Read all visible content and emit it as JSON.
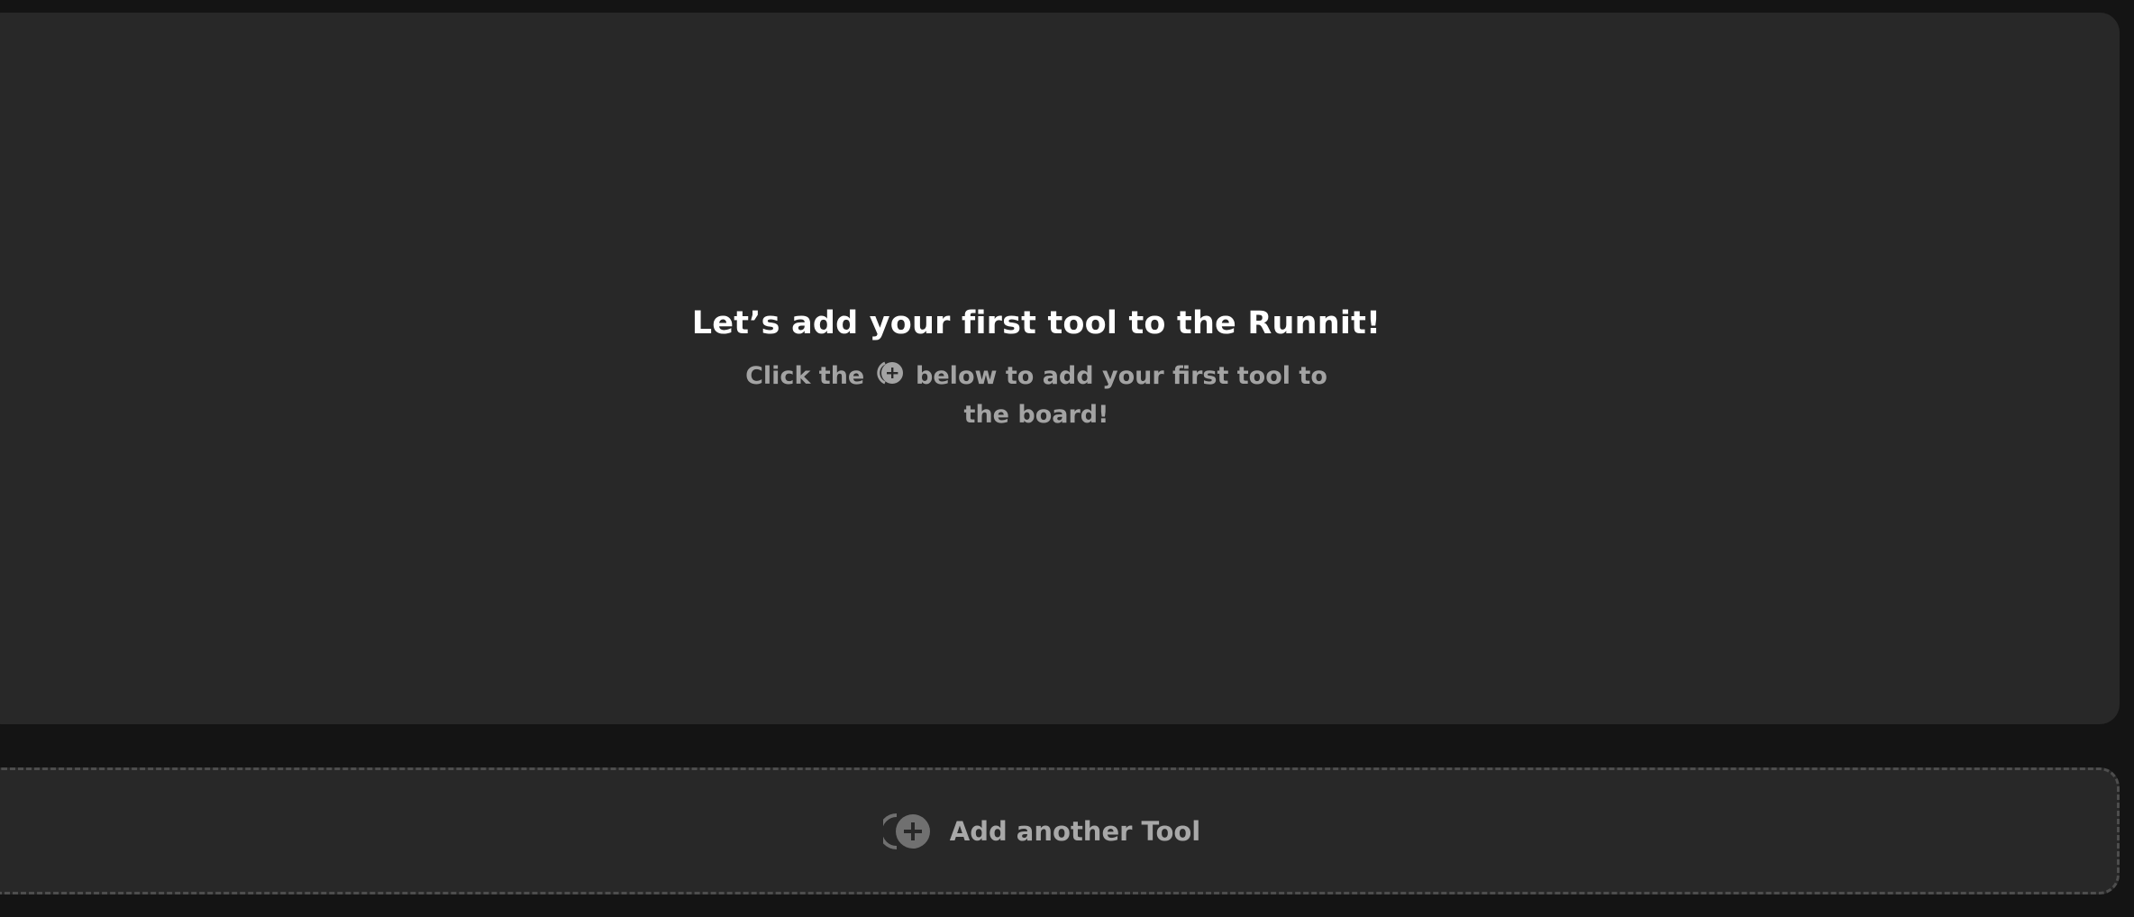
{
  "board": {
    "title": "Let’s add your first tool to the Runnit!",
    "subtitle_before": "Click the ",
    "subtitle_icon": "add-circle-icon",
    "subtitle_after": " below to add your first tool to the board!"
  },
  "add_tool": {
    "icon": "add-circle-icon",
    "label": "Add another Tool"
  },
  "colors": {
    "background": "#141414",
    "panel": "#282828",
    "title": "#ffffff",
    "muted_text": "#a3a3a3",
    "dashed_border": "#4d4d4d"
  }
}
